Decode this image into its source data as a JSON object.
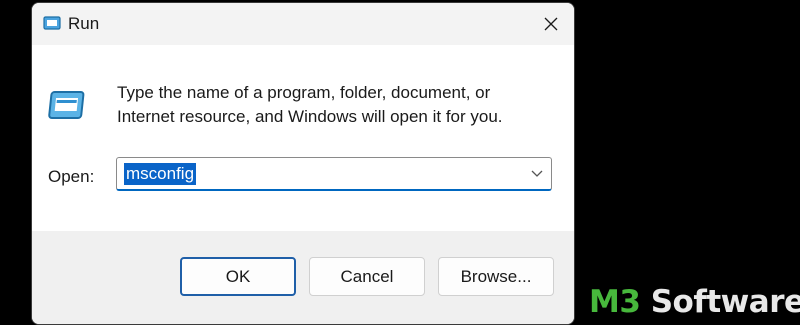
{
  "window": {
    "title": "Run",
    "icon": "run-icon",
    "close_icon": "close-icon"
  },
  "content": {
    "description": "Type the name of a program, folder, document, or Internet resource, and Windows will open it for you.",
    "open_label": "Open:",
    "open_value": "msconfig",
    "dropdown_icon": "chevron-down-icon"
  },
  "buttons": {
    "ok": "OK",
    "cancel": "Cancel",
    "browse": "Browse..."
  },
  "watermark": {
    "brand_prefix": "M3",
    "brand_suffix": " Software"
  },
  "colors": {
    "accent": "#0067c0",
    "selection": "#0a64c8",
    "watermark_green": "#47b83c"
  }
}
